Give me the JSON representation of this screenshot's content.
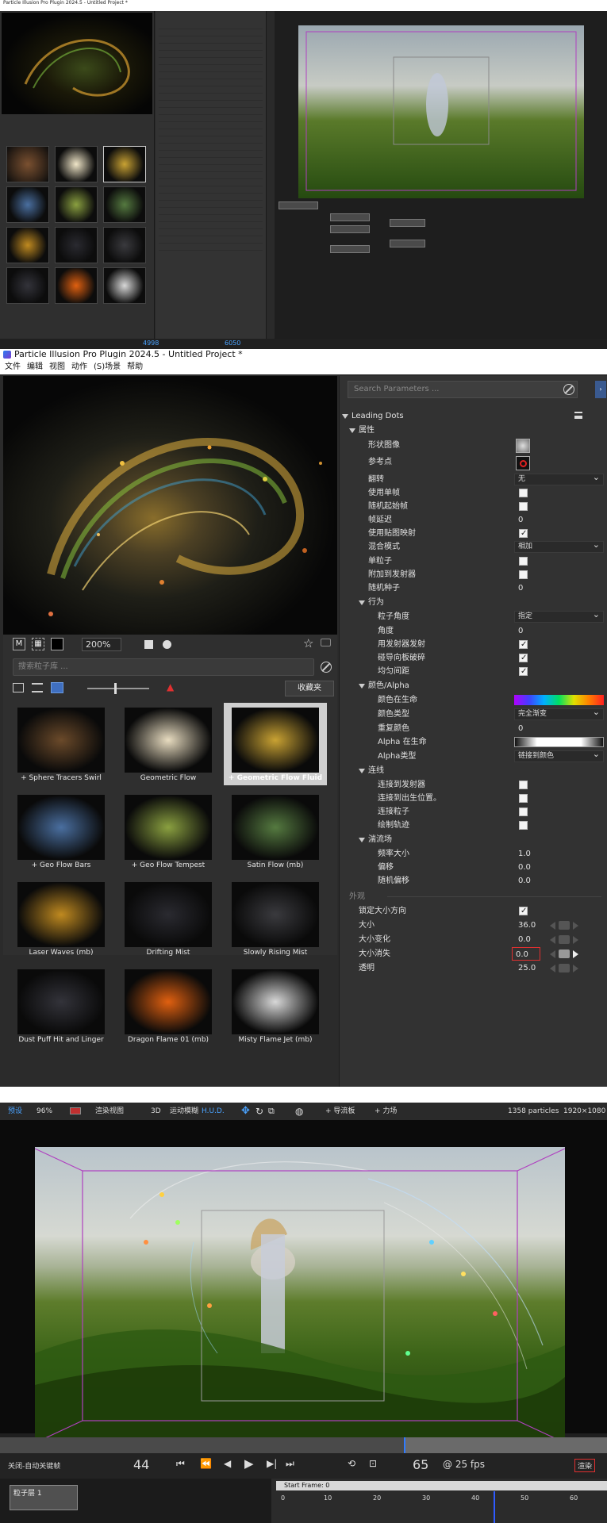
{
  "overview": {
    "window_title": "Particle Illusion Pro Plugin 2024.5 - Untitled Project *",
    "bottom_frame_start": "4998",
    "bottom_frame_end": "6050"
  },
  "app": {
    "window_title": "Particle Illusion Pro Plugin 2024.5 - Untitled Project *",
    "menu": [
      "文件",
      "编辑",
      "视图",
      "动作",
      "(S)场景",
      "帮助"
    ]
  },
  "preview": {
    "zoom": "200%",
    "mode_button": "M",
    "library_search_placeholder": "搜索粒子库 ...",
    "favorites_button": "收藏夹",
    "library_items": [
      {
        "label": "+ Sphere Tracers Swirl",
        "selected": false,
        "thumb": "#6b4a2a"
      },
      {
        "label": "Geometric Flow",
        "selected": false,
        "thumb": "#e8dcc0"
      },
      {
        "label": "+ Geometric Flow Fluid",
        "selected": true,
        "thumb": "#c9a233"
      },
      {
        "label": "+ Geo Flow Bars",
        "selected": false,
        "thumb": "#4a6fa0"
      },
      {
        "label": "+ Geo Flow Tempest",
        "selected": false,
        "thumb": "#8aa040"
      },
      {
        "label": "Satin Flow (mb)",
        "selected": false,
        "thumb": "#557a40"
      },
      {
        "label": "Laser Waves (mb)",
        "selected": false,
        "thumb": "#c08a20"
      },
      {
        "label": "Drifting Mist",
        "selected": false,
        "thumb": "#2a2a30"
      },
      {
        "label": "Slowly Rising Mist",
        "selected": false,
        "thumb": "#3a3a3e"
      },
      {
        "label": "Dust Puff Hit and Linger",
        "selected": false,
        "thumb": "#33333a"
      },
      {
        "label": "Dragon Flame 01 (mb)",
        "selected": false,
        "thumb": "#e06010"
      },
      {
        "label": "Misty Flame Jet (mb)",
        "selected": false,
        "thumb": "#d8d8d8"
      }
    ]
  },
  "params": {
    "search_placeholder": "Search Parameters ...",
    "emitter_name": "Leading Dots",
    "group_properties": "属性",
    "shape_image": "形状图像",
    "ref_point": "参考点",
    "flip": "翻转",
    "flip_value": "无",
    "use_single_frame": "使用单帧",
    "random_start_frame": "随机起始帧",
    "frame_delay": "帧延迟",
    "frame_delay_value": "0",
    "use_texture_map": "使用贴图映射",
    "blend_mode": "混合模式",
    "blend_mode_value": "相加",
    "single_particle": "单粒子",
    "attach_to_emitter": "附加到发射器",
    "random_seed": "随机种子",
    "random_seed_value": "0",
    "group_behavior": "行为",
    "particle_angle": "粒子角度",
    "particle_angle_value": "指定",
    "angle": "角度",
    "angle_value": "0",
    "emit_with_emitter": "用发射器发射",
    "break_on_collision": "碰导向板破碎",
    "even_spacing": "均匀间距",
    "group_color": "颜色/Alpha",
    "color_over_life": "颜色在生命",
    "color_type": "颜色类型",
    "color_type_value": "完全渐变",
    "repeat_color": "重复颜色",
    "repeat_color_value": "0",
    "alpha_over_life": "Alpha 在生命",
    "alpha_type": "Alpha类型",
    "alpha_type_value": "链接到颜色",
    "group_lines": "连线",
    "connect_to_emitter": "连接到发射器",
    "connect_to_birth": "连接到出生位置。",
    "connect_particles": "连接粒子",
    "draw_trail": "绘制轨迹",
    "group_turbulence": "湍流场",
    "freq_size": "频率大小",
    "freq_size_value": "1.0",
    "offset": "偏移",
    "offset_value": "0.0",
    "random_offset": "随机偏移",
    "random_offset_value": "0.0",
    "section_appearance": "外观",
    "lock_size_aspect": "锁定大小方向",
    "size": "大小",
    "size_value": "36.0",
    "size_variation": "大小变化",
    "size_variation_value": "0.0",
    "size_fade": "大小消失",
    "size_fade_value": "0.0",
    "opacity": "透明",
    "opacity_value": "25.0"
  },
  "viewport": {
    "preset_label": "预设",
    "zoom": "96%",
    "render_view": "渲染视图",
    "mode_3d": "3D",
    "motion_blur": "运动模糊",
    "hud": "H.U.D.",
    "add_flow": "+ 导流板",
    "add_force": "+ 力场",
    "particle_count": "1358 particles",
    "resolution": "1920×1080",
    "autokey": "关闭-自动关键帧",
    "frame_current": "44",
    "frame_end": "65",
    "fps": "@ 25 fps",
    "render_btn": "渲染",
    "node_name": "粒子层 1",
    "start_frame": "Start Frame: 0",
    "ruler_ticks": [
      "0",
      "10",
      "20",
      "30",
      "40",
      "50",
      "60"
    ]
  },
  "colors": {
    "accent_blue": "#2f7bff",
    "red_outline": "#e03030",
    "gradient_rainbow": "linear-gradient(90deg,#b000ff,#4040ff,#00b0ff,#00e060,#e0e000,#ff8000,#ff2020)"
  }
}
